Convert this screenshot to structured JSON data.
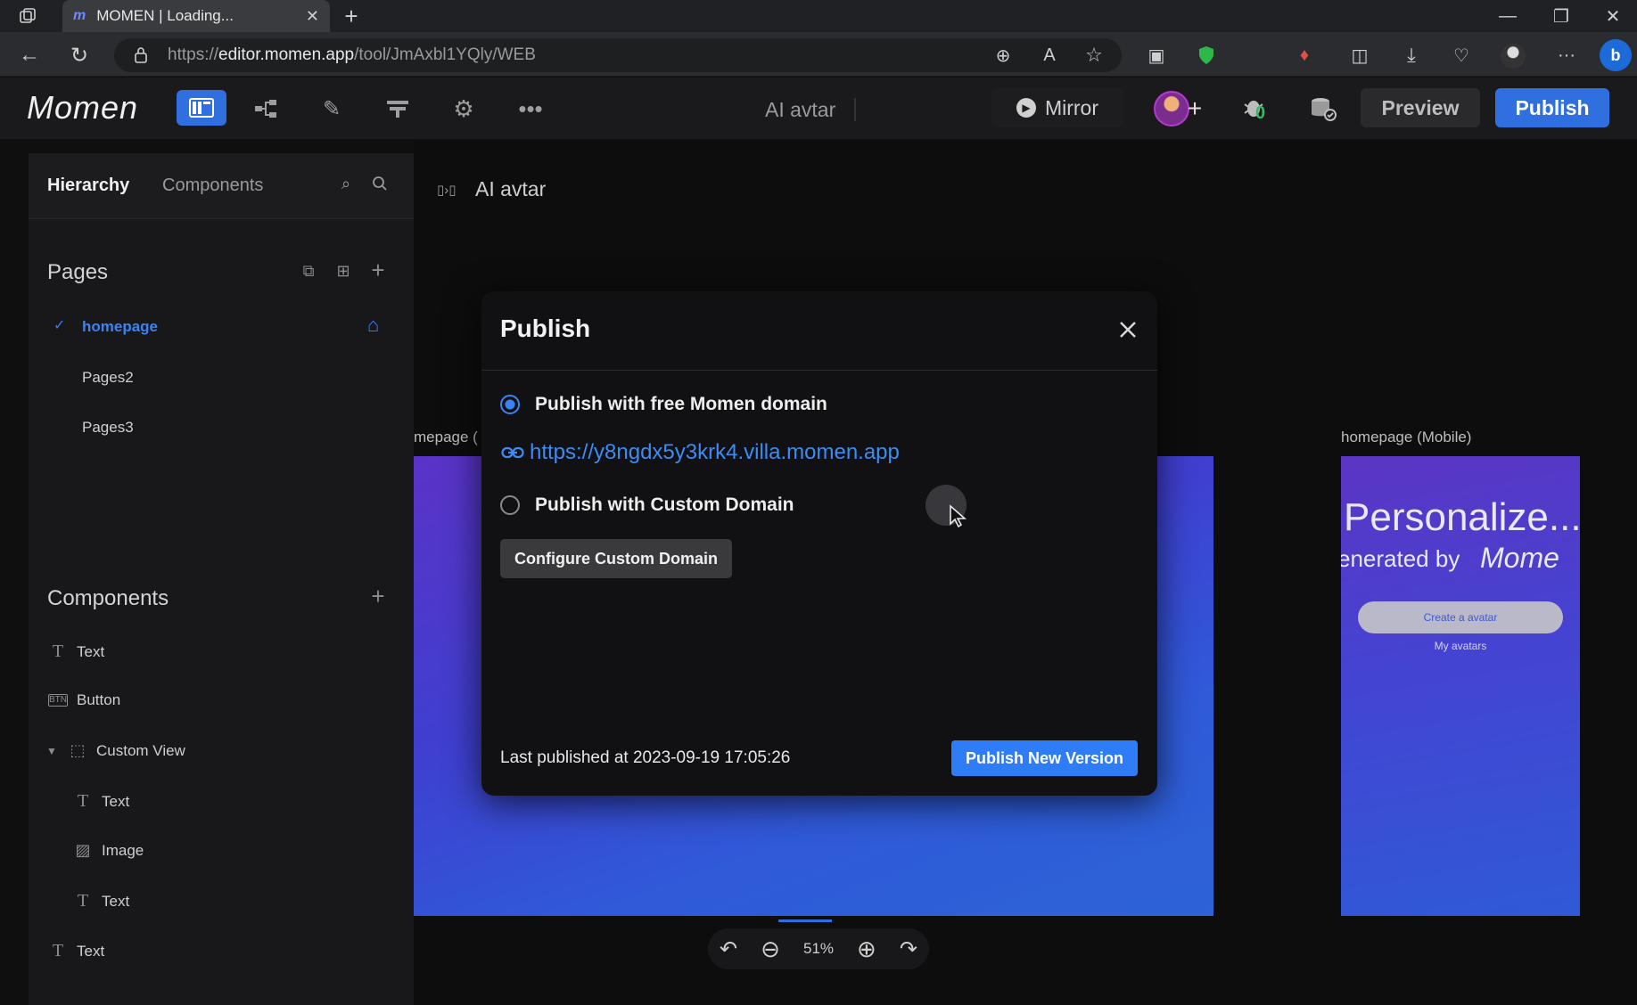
{
  "browser": {
    "tab_title": "MOMEN | Loading...",
    "url_prefix": "https://",
    "url_host": "editor.momen.app",
    "url_path": "/tool/JmAxbl1YQly/WEB"
  },
  "header": {
    "logo_text": "Momen",
    "project_title": "AI avtar",
    "mirror_label": "Mirror",
    "preview_label": "Preview",
    "publish_label": "Publish",
    "notification_count": "0",
    "accent": "#2f6fe0"
  },
  "sidebar": {
    "tabs": [
      "Hierarchy",
      "Components"
    ],
    "pages_heading": "Pages",
    "pages": [
      {
        "label": "homepage",
        "active": true
      },
      {
        "label": "Pages2",
        "active": false
      },
      {
        "label": "Pages3",
        "active": false
      }
    ],
    "components_heading": "Components",
    "components": [
      {
        "label": "Text",
        "icon": "text-icon"
      },
      {
        "label": "Button",
        "icon": "button-icon"
      },
      {
        "label": "Custom View",
        "icon": "custom-view-icon"
      },
      {
        "label": "Text",
        "icon": "text-icon"
      },
      {
        "label": "Image",
        "icon": "image-icon"
      },
      {
        "label": "Text",
        "icon": "text-icon"
      },
      {
        "label": "Text",
        "icon": "text-icon"
      }
    ]
  },
  "canvas": {
    "breadcrumb": "AI avtar",
    "web_frame_label": "mepage (",
    "mobile_frame_label": "homepage (Mobile)",
    "mobile_preview": {
      "headline": "Personalize...",
      "subline": "enerated by",
      "brand": "Mome",
      "cta": "Create a avatar",
      "link": "My avatars"
    },
    "zoom_level": "51%"
  },
  "modal": {
    "title": "Publish",
    "option_free": "Publish with free Momen domain",
    "free_domain_url": "https://y8ngdx5y3krk4.villa.momen.app",
    "option_custom": "Publish with Custom Domain",
    "configure_button": "Configure Custom Domain",
    "last_published": "Last published at 2023-09-19 17:05:26",
    "publish_new_button": "Publish New Version",
    "selected_option": "free"
  }
}
